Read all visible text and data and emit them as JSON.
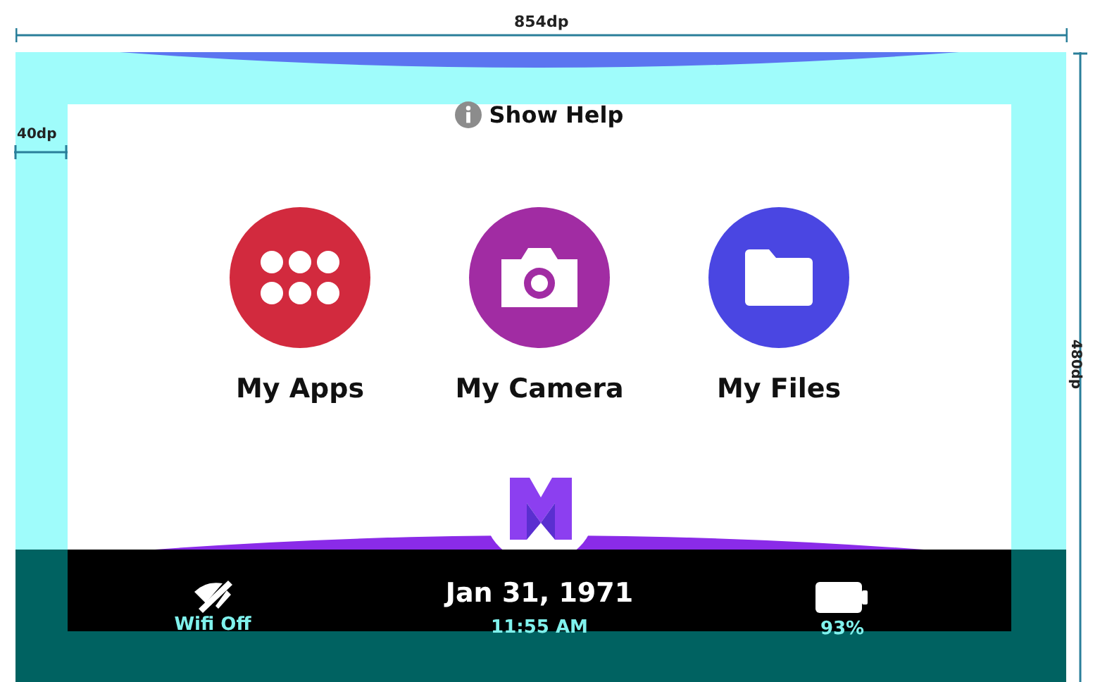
{
  "dimensions": {
    "width": "854dp",
    "margin": "40dp",
    "height": "480dp"
  },
  "help": {
    "label": "Show Help"
  },
  "apps": [
    {
      "kind": "apps",
      "label": "My Apps",
      "color": "#d22a3e"
    },
    {
      "kind": "camera",
      "label": "My Camera",
      "color": "#a12ca3"
    },
    {
      "kind": "files",
      "label": "My Files",
      "color": "#4a46e2"
    }
  ],
  "status_bar": {
    "wifi": "Wifi Off",
    "date": "Jan 31, 1971",
    "time": "11:55 AM",
    "battery": "93%"
  }
}
